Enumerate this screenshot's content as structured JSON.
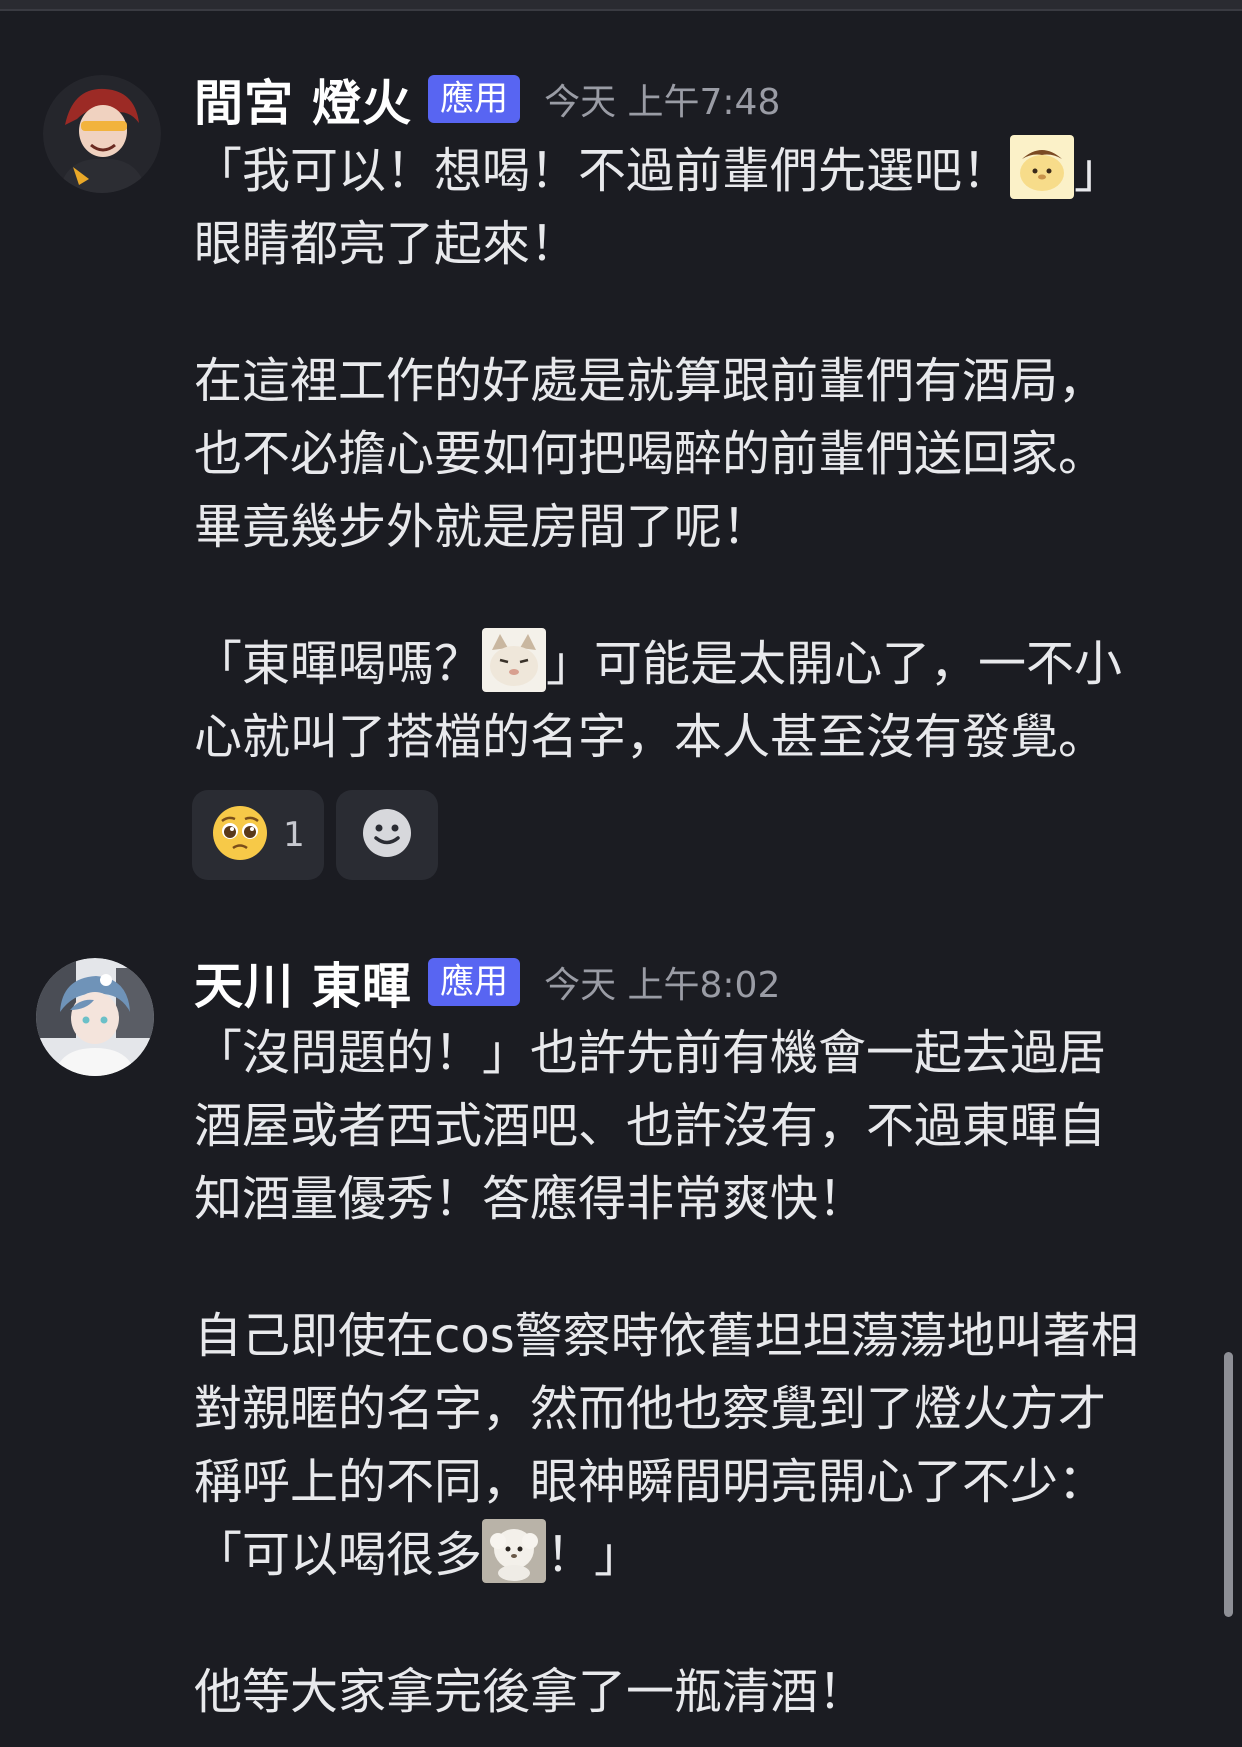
{
  "messages": [
    {
      "author": "間宮 燈火",
      "badge": "應用",
      "time": "今天 上午7:48",
      "lines": {
        "l1a": "「我可以！想喝！不過前輩們先選吧！",
        "l1b": "」",
        "l2": "眼睛都亮了起來！",
        "l3": "在這裡工作的好處是就算跟前輩們有酒局，",
        "l4": "也不必擔心要如何把喝醉的前輩們送回家。",
        "l5": "畢竟幾步外就是房間了呢！",
        "l6a": "「東暉喝嗎？",
        "l6b": "」可能是太開心了，一不小",
        "l7": "心就叫了搭檔的名字，本人甚至沒有發覺。"
      },
      "reactions": [
        {
          "emoji": "pleading-face",
          "count": "1"
        },
        {
          "emoji": "add-reaction",
          "count": ""
        }
      ]
    },
    {
      "author": "天川 東暉",
      "badge": "應用",
      "time": "今天 上午8:02",
      "lines": {
        "l1": "「沒問題的！」也許先前有機會一起去過居",
        "l2": "酒屋或者西式酒吧、也許沒有，不過東暉自",
        "l3": "知酒量優秀！答應得非常爽快！",
        "l4": "自己即使在cos警察時依舊坦坦蕩蕩地叫著相",
        "l5": "對親暱的名字，然而他也察覺到了燈火方才",
        "l6": "稱呼上的不同，眼神瞬間明亮開心了不少：",
        "l7a": "「可以喝很多",
        "l7b": "！」",
        "l8": "他等大家拿完後拿了一瓶清酒！"
      }
    }
  ],
  "colors": {
    "background": "#1b1c22",
    "badge": "#5865f2",
    "text": "#e8e9ec",
    "timestamp": "#9a9ca5"
  }
}
